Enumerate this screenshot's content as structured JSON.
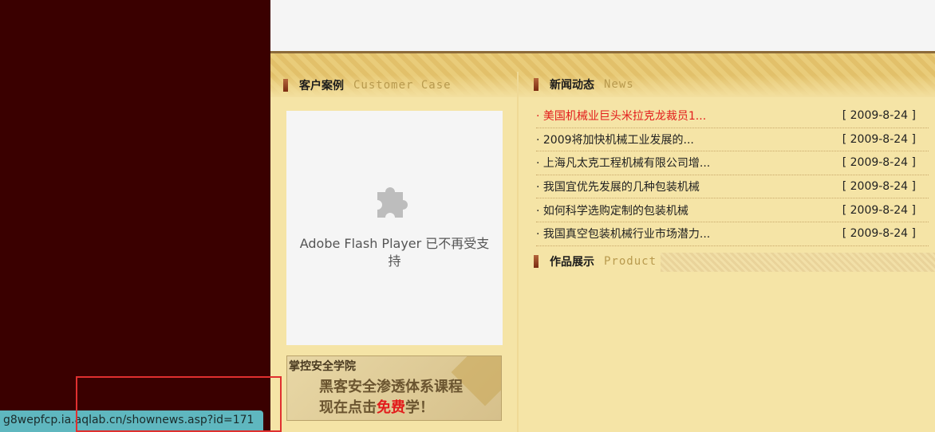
{
  "cases_section": {
    "title": "客户案例",
    "subtitle_en": "Customer Case"
  },
  "news_section": {
    "title": "新闻动态",
    "subtitle_en": "News"
  },
  "product_section": {
    "title": "作品展示",
    "subtitle_en": "Product"
  },
  "flash_placeholder": {
    "message": "Adobe Flash Player 已不再受支持",
    "icon": "puzzle-piece-icon"
  },
  "ad": {
    "school": "掌控安全学院",
    "line1": "黑客安全渗透体系课程",
    "line2_prefix": "现在点击",
    "line2_free": "免费",
    "line2_suffix": "学！"
  },
  "news": [
    {
      "title": "· 美国机械业巨头米拉克龙裁员1...",
      "date": "[ 2009-8-24 ]",
      "hot": true
    },
    {
      "title": "· 2009将加快机械工业发展的...",
      "date": "[ 2009-8-24 ]",
      "hot": false
    },
    {
      "title": "· 上海凡太克工程机械有限公司增...",
      "date": "[ 2009-8-24 ]",
      "hot": false
    },
    {
      "title": "· 我国宜优先发展的几种包装机械",
      "date": "[ 2009-8-24 ]",
      "hot": false
    },
    {
      "title": "· 如何科学选购定制的包装机械",
      "date": "[ 2009-8-24 ]",
      "hot": false
    },
    {
      "title": "· 我国真空包装机械行业市场潜力...",
      "date": "[ 2009-8-24 ]",
      "hot": false
    }
  ],
  "status_bar": {
    "url": "g8wepfcp.ia.aqlab.cn/shownews.asp?id=171"
  },
  "colors": {
    "left_bg": "#3a0000",
    "panel_bg": "#f5e4a6",
    "hot_news": "#e21c1c",
    "status_bar": "#5fb7bf"
  }
}
